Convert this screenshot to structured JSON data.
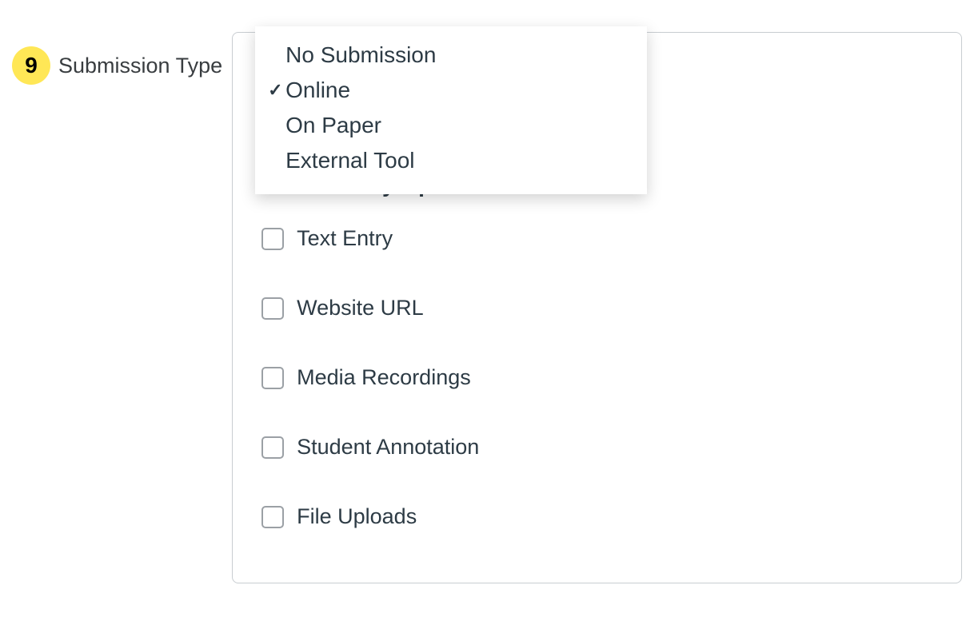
{
  "step": {
    "number": "9",
    "label": "Submission Type"
  },
  "dropdown": {
    "selectedIndex": 1,
    "options": [
      {
        "label": "No Submission",
        "selected": false
      },
      {
        "label": "Online",
        "selected": true
      },
      {
        "label": "On Paper",
        "selected": false
      },
      {
        "label": "External Tool",
        "selected": false
      }
    ]
  },
  "checkmark": "✓",
  "entrySection": {
    "title": "Online Entry Options",
    "options": [
      {
        "label": "Text Entry",
        "checked": false
      },
      {
        "label": "Website URL",
        "checked": false
      },
      {
        "label": "Media Recordings",
        "checked": false
      },
      {
        "label": "Student Annotation",
        "checked": false
      },
      {
        "label": "File Uploads",
        "checked": false
      }
    ]
  }
}
